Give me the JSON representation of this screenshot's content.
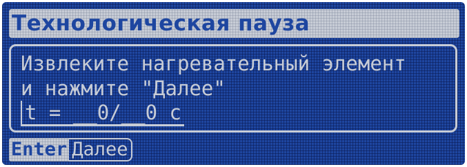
{
  "screen": {
    "title": "Технологическая пауза",
    "message_line1": "Извлеките нагревательный элемент",
    "message_line2": "и нажмите \"Далее\"",
    "temperature_field": "t = __0/__0 c"
  },
  "soft_key": {
    "key": "Enter",
    "action": "Далее"
  },
  "colors": {
    "lcd_background": "#1e46a0",
    "pixel_light": "#c7ccd6"
  }
}
